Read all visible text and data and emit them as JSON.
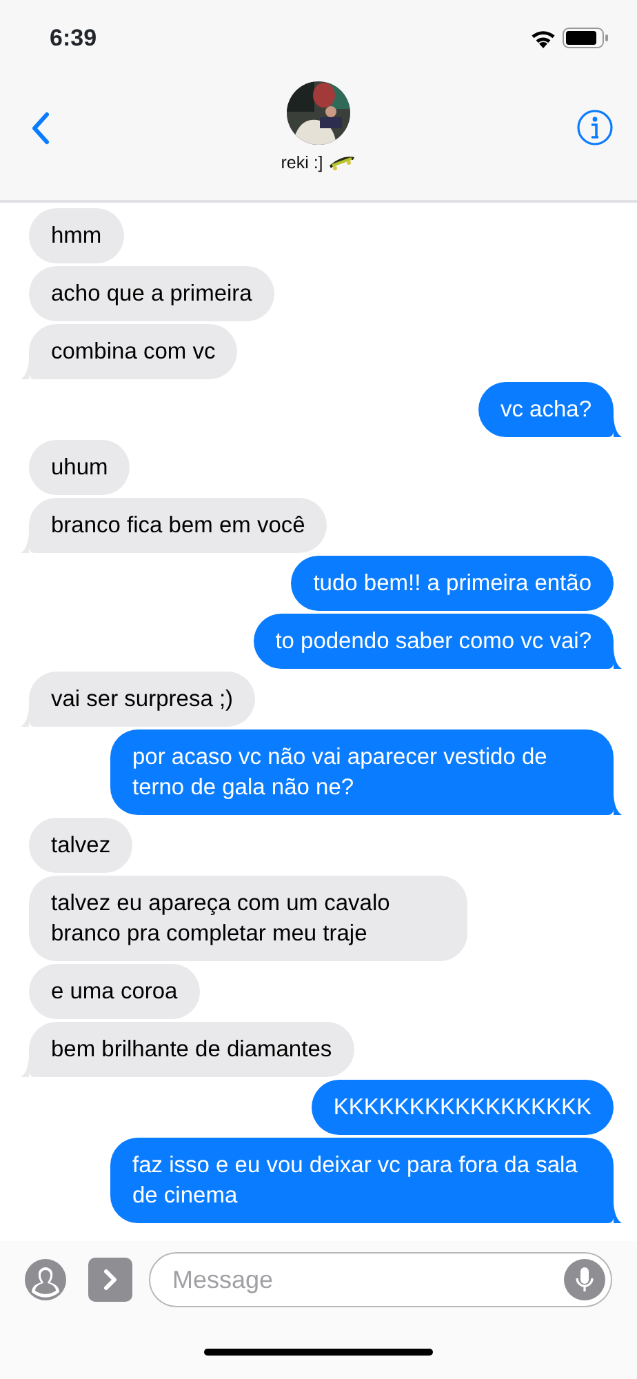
{
  "status_bar": {
    "time": "6:39"
  },
  "contact": {
    "name": "reki :]"
  },
  "messages": [
    {
      "kind": "received",
      "text": "hmm",
      "tail": false
    },
    {
      "kind": "received",
      "text": "acho que a primeira",
      "tail": false
    },
    {
      "kind": "received",
      "text": "combina com vc",
      "tail": true
    },
    {
      "kind": "sent",
      "text": "vc acha?",
      "tail": true
    },
    {
      "kind": "received",
      "text": "uhum",
      "tail": false
    },
    {
      "kind": "received",
      "text": "branco fica bem em você",
      "tail": true
    },
    {
      "kind": "sent",
      "text": "tudo bem!! a primeira então",
      "tail": false
    },
    {
      "kind": "sent",
      "text": "to podendo saber como vc vai?",
      "tail": true
    },
    {
      "kind": "received",
      "text": "vai ser surpresa ;)",
      "tail": true
    },
    {
      "kind": "sent",
      "text": "por acaso vc não vai aparecer vestido de terno de gala não ne?",
      "tail": true
    },
    {
      "kind": "received",
      "text": "talvez",
      "tail": false
    },
    {
      "kind": "received",
      "text": "talvez eu apareça com um cavalo branco pra completar meu traje",
      "tail": false
    },
    {
      "kind": "received",
      "text": "e uma coroa",
      "tail": false
    },
    {
      "kind": "received",
      "text": "bem brilhante de diamantes",
      "tail": true
    },
    {
      "kind": "sent",
      "text": "KKKKKKKKKKKKKKKKK",
      "tail": false
    },
    {
      "kind": "sent",
      "text": "faz isso e eu vou deixar vc para fora da sala de cinema",
      "tail": true
    }
  ],
  "composer": {
    "placeholder": "Message"
  }
}
